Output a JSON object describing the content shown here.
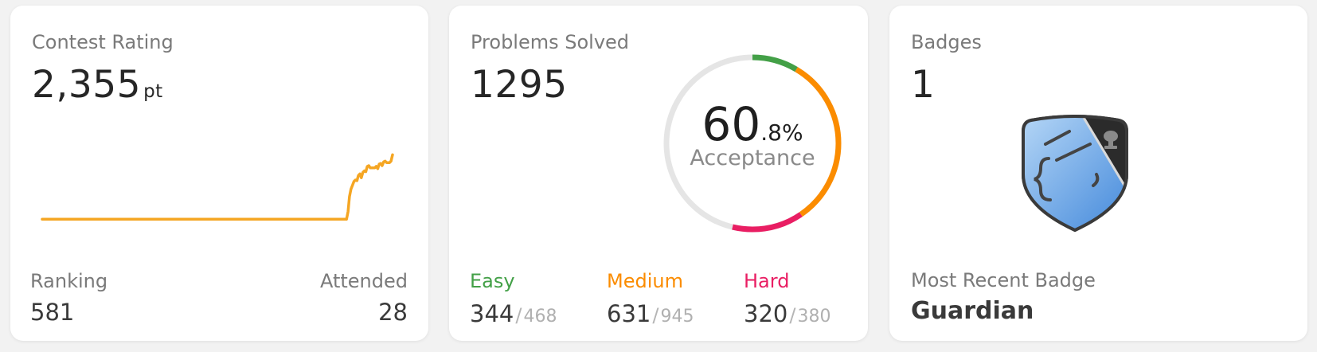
{
  "contest": {
    "title": "Contest Rating",
    "rating": "2,355",
    "unit": "pt",
    "ranking_label": "Ranking",
    "ranking_value": "581",
    "attended_label": "Attended",
    "attended_value": "28",
    "line_color": "#f5a623"
  },
  "chart_data": {
    "type": "line",
    "title": "",
    "xlabel": "",
    "ylabel": "",
    "grid": false,
    "series": [
      {
        "values": [
          1500,
          1500,
          1500,
          1500,
          1500,
          1500,
          1500,
          1500,
          1500,
          1500,
          1500,
          1500,
          1500,
          1500,
          1500,
          1500,
          1500,
          1500,
          1500,
          1500,
          1500,
          1500,
          1500,
          1500,
          1500,
          1500,
          1500,
          1500,
          1500,
          1500,
          1500,
          1500,
          1500,
          1500,
          1500,
          1500,
          1500,
          1500,
          1500,
          1500,
          1500,
          1500,
          1500,
          1500,
          1500,
          1500,
          1500,
          1500,
          1500,
          1500,
          1500,
          1500,
          1500,
          1500,
          1500,
          1500,
          1500,
          1500,
          1500,
          1500,
          1500,
          1500,
          1500,
          1500,
          1500,
          1500,
          1500,
          1500,
          1500,
          1500,
          1500,
          1500,
          1500,
          1500,
          1500,
          1500,
          1500,
          1500,
          1500,
          1500,
          1500,
          1500,
          1500,
          1500,
          1500,
          1500,
          1500,
          1500,
          1500,
          1500,
          1500,
          1500,
          1500,
          1500,
          1500,
          1500,
          1500,
          1500,
          1500,
          1500,
          1500,
          1500,
          1500,
          1500,
          1500,
          1500,
          1500,
          1500,
          1500,
          1500,
          1500,
          1500,
          1500,
          1500,
          1500,
          1500,
          1500,
          1500,
          1500,
          1500,
          1500,
          1500,
          1500,
          1500,
          1500,
          1500,
          1500,
          1500,
          1500,
          1500,
          1500,
          1500,
          1500,
          1500,
          1500,
          1500,
          1500,
          1500,
          1500,
          1500,
          1500,
          1500,
          1500,
          1500,
          1500,
          1500,
          1500,
          1500,
          1500,
          1500,
          1500,
          1500,
          1500,
          1500,
          1500,
          1500,
          1500,
          1500,
          1500,
          1500,
          1500,
          1500,
          1500,
          1500,
          1500,
          1500,
          1500,
          1500,
          1500,
          1500,
          1500,
          1500,
          1500,
          1500,
          1500,
          1500,
          1500,
          1500,
          1500,
          1500,
          1500,
          1500,
          1500,
          1500,
          1500,
          1500,
          1500,
          1500,
          1500,
          1500,
          1500,
          1500,
          1500,
          1500,
          1500,
          1500,
          1500,
          1500,
          1500,
          1500,
          1500,
          1500,
          1500,
          1500,
          1500,
          1500,
          1600,
          1800,
          1900,
          1950,
          2000,
          2020,
          2010,
          2080,
          2100,
          2050,
          2120,
          2140,
          2130,
          2200,
          2210,
          2180,
          2180,
          2180,
          2180,
          2200,
          2170,
          2230,
          2240,
          2210,
          2260,
          2270,
          2250,
          2250,
          2250,
          2270,
          2355
        ]
      }
    ],
    "ylim": [
      1450,
      2400
    ]
  },
  "problems": {
    "title": "Problems Solved",
    "solved": "1295",
    "accept_int": "60",
    "accept_dec": ".8%",
    "accept_label": "Acceptance",
    "colors": {
      "easy": "#43a047",
      "medium": "#fb8c00",
      "hard": "#e91e63",
      "track": "#e5e5e5"
    },
    "easy": {
      "label": "Easy",
      "solved": "344",
      "sep": "/",
      "total": "468"
    },
    "medium": {
      "label": "Medium",
      "solved": "631",
      "sep": "/",
      "total": "945"
    },
    "hard": {
      "label": "Hard",
      "solved": "320",
      "sep": "/",
      "total": "380"
    },
    "ring_fraction": {
      "easy": 0.0852,
      "medium": 0.3194,
      "hard": 0.1324
    }
  },
  "badges": {
    "title": "Badges",
    "count": "1",
    "badge_icon": "guardian-badge-icon",
    "recent_label": "Most Recent Badge",
    "recent_name": "Guardian"
  }
}
